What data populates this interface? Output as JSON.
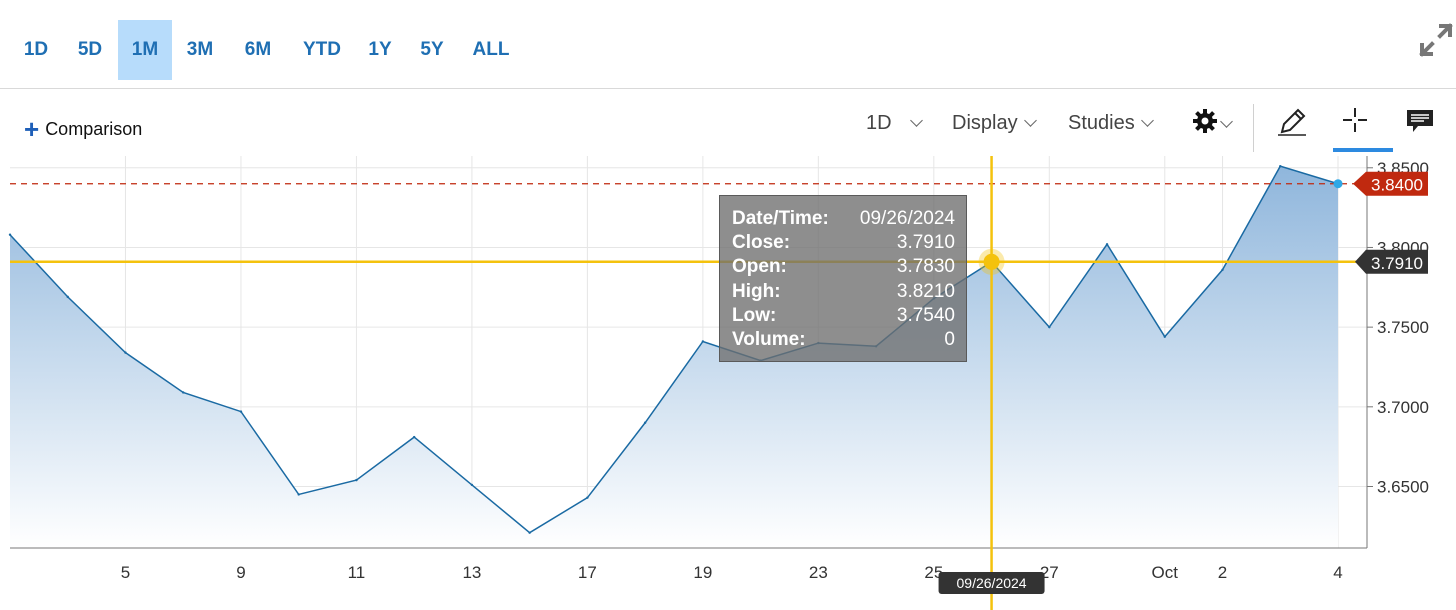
{
  "range_tabs": [
    {
      "label": "1D",
      "active": false
    },
    {
      "label": "5D",
      "active": false
    },
    {
      "label": "1M",
      "active": true
    },
    {
      "label": "3M",
      "active": false
    },
    {
      "label": "6M",
      "active": false
    },
    {
      "label": "YTD",
      "active": false
    },
    {
      "label": "1Y",
      "active": false
    },
    {
      "label": "5Y",
      "active": false
    },
    {
      "label": "ALL",
      "active": false
    }
  ],
  "toolbar": {
    "comparison_label": "Comparison",
    "interval_label": "1D",
    "display_label": "Display",
    "studies_label": "Studies"
  },
  "tooltip": {
    "rows": [
      {
        "label": "Date/Time:",
        "value": "09/26/2024"
      },
      {
        "label": "Close:",
        "value": "3.7910"
      },
      {
        "label": "Open:",
        "value": "3.7830"
      },
      {
        "label": "High:",
        "value": "3.8210"
      },
      {
        "label": "Low:",
        "value": "3.7540"
      },
      {
        "label": "Volume:",
        "value": "0"
      }
    ]
  },
  "colors": {
    "accent": "#1f6fb3",
    "line": "#1a6aa3",
    "crosshair": "#f4c20d",
    "last_price": "#c0290f",
    "crosshair_badge": "#333333",
    "last_dot": "#2fa8e6"
  },
  "chart_data": {
    "type": "area",
    "x": [
      "Sep 3",
      "Sep 4",
      "Sep 5",
      "Sep 6",
      "Sep 9",
      "Sep 10",
      "Sep 11",
      "Sep 12",
      "Sep 13",
      "Sep 16",
      "Sep 17",
      "Sep 18",
      "Sep 19",
      "Sep 20",
      "Sep 23",
      "Sep 24",
      "Sep 25",
      "Sep 26",
      "Sep 27",
      "Sep 30",
      "Oct 1",
      "Oct 2",
      "Oct 3",
      "Oct 4"
    ],
    "values": [
      3.808,
      3.769,
      3.734,
      3.709,
      3.697,
      3.645,
      3.654,
      3.681,
      3.651,
      3.621,
      3.643,
      3.69,
      3.741,
      3.729,
      3.74,
      3.738,
      3.768,
      3.791,
      3.75,
      3.802,
      3.744,
      3.786,
      3.851,
      3.84
    ],
    "x_ticks": [
      {
        "index": 2,
        "label": "5"
      },
      {
        "index": 4,
        "label": "9"
      },
      {
        "index": 6,
        "label": "11"
      },
      {
        "index": 8,
        "label": "13"
      },
      {
        "index": 10,
        "label": "17"
      },
      {
        "index": 12,
        "label": "19"
      },
      {
        "index": 14,
        "label": "23"
      },
      {
        "index": 16,
        "label": "25"
      },
      {
        "index": 18,
        "label": "27"
      },
      {
        "index": 20,
        "label": "Oct"
      },
      {
        "index": 21,
        "label": "2"
      },
      {
        "index": 23,
        "label": "4"
      }
    ],
    "y_ticks": [
      {
        "value": 3.65,
        "label": "3.6500"
      },
      {
        "value": 3.7,
        "label": "3.7000"
      },
      {
        "value": 3.75,
        "label": "3.7500"
      },
      {
        "value": 3.8,
        "label": "3.8000"
      },
      {
        "value": 3.85,
        "label": "3.8500"
      }
    ],
    "ylim": [
      3.6114,
      3.8574
    ],
    "last_price": {
      "value": 3.84,
      "label": "3.8400"
    },
    "crosshair": {
      "index": 17,
      "value": 3.791,
      "y_label": "3.7910",
      "x_label": "09/26/2024"
    },
    "grid": true
  }
}
